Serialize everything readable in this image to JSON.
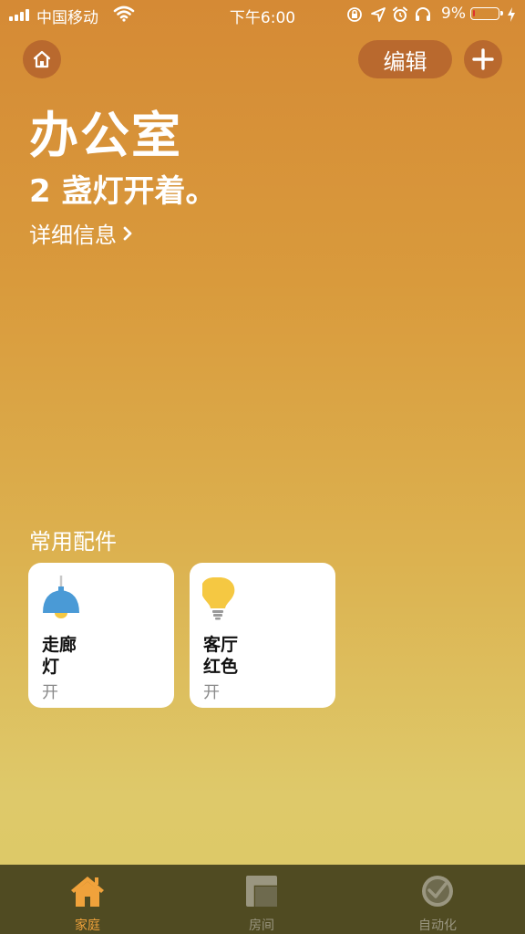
{
  "status_bar": {
    "carrier": "中国移动",
    "time": "下午6:00",
    "battery_percent": "9%",
    "battery_level": 0.09,
    "icons": [
      "signal-icon",
      "wifi-icon",
      "orientation-lock-icon",
      "location-icon",
      "alarm-icon",
      "headphones-icon",
      "battery-icon",
      "charging-icon"
    ]
  },
  "header": {
    "home_icon": "home-icon",
    "edit_label": "编辑",
    "add_icon": "plus-icon"
  },
  "room": {
    "title": "办公室",
    "status": "2 盏灯开着。",
    "detail_link": "详细信息"
  },
  "favorites": {
    "title": "常用配件",
    "accessories": [
      {
        "name_line1": "走廊",
        "name_line2": "灯",
        "state": "开",
        "icon": "pendant-lamp-icon",
        "icon_color": "#4a9ad6"
      },
      {
        "name_line1": "客厅",
        "name_line2": "红色",
        "state": "开",
        "icon": "light-bulb-icon",
        "icon_color": "#f5c842"
      }
    ]
  },
  "tabbar": {
    "tabs": [
      {
        "label": "家庭",
        "icon": "home-tab-icon",
        "active": true
      },
      {
        "label": "房间",
        "icon": "rooms-tab-icon",
        "active": false
      },
      {
        "label": "自动化",
        "icon": "automation-clock-icon",
        "active": false
      }
    ],
    "active_color": "#f0a23b",
    "inactive_color": "#9a9680"
  }
}
